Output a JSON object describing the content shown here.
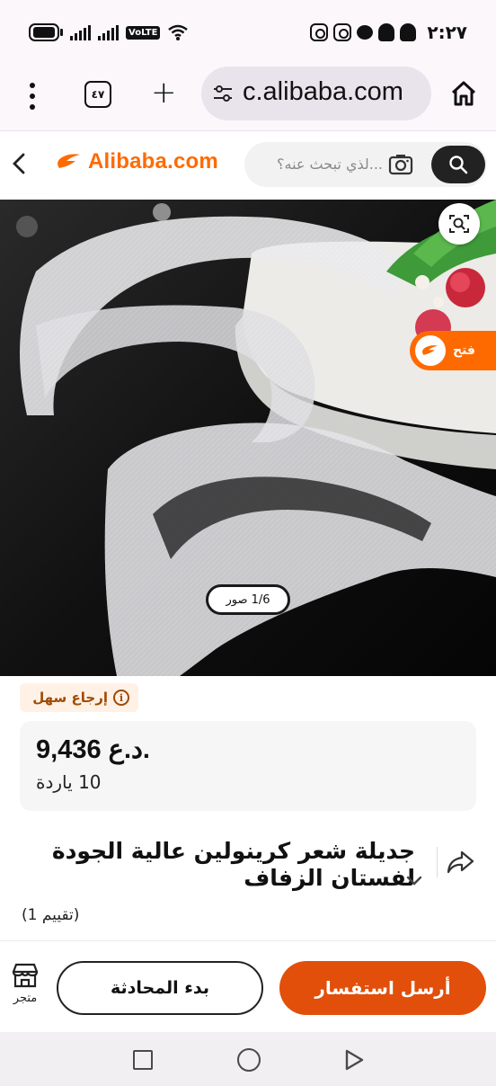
{
  "status_bar": {
    "time": "٢:٢٧",
    "network_label": "VoLTE",
    "icons": [
      "battery-icon",
      "signal-icon",
      "signal-icon",
      "volte-icon",
      "wifi-icon",
      "instagram-icon",
      "instagram-icon",
      "messenger-icon",
      "snapchat-icon",
      "snapchat-icon"
    ]
  },
  "browser": {
    "tab_count": "٤٧",
    "url": "c.alibaba.com",
    "icons": [
      "menu-dots-icon",
      "tabs-icon",
      "plus-icon",
      "site-settings-icon",
      "home-icon"
    ]
  },
  "header": {
    "brand": "Alibaba.com",
    "search_placeholder": "...لذي تبحث عنه؟",
    "icons": [
      "back-chevron-icon",
      "alibaba-logo-icon",
      "camera-icon",
      "search-icon"
    ]
  },
  "gallery": {
    "photo_counter": "1/6 صور",
    "open_app_label": "فتح",
    "icons": [
      "image-search-icon",
      "alibaba-app-icon"
    ]
  },
  "product": {
    "return_badge": "إرجاع سهل",
    "price": "9,436 د.ع.",
    "unit": "10 ياردة",
    "title": "جديلة شعر كرينولين عالية الجودة لفستان الزفاف",
    "rating": "(تقييم 1)",
    "icons": [
      "info-icon",
      "share-icon",
      "chevron-down-icon"
    ]
  },
  "actions": {
    "store_label": "متجر",
    "chat_label": "بدء المحادثة",
    "inquiry_label": "أرسل استفسار",
    "accent_color": "#e14f0b",
    "brand_color": "#ff6a00"
  },
  "nav": {
    "icons": [
      "recents-icon",
      "home-circle-icon",
      "back-triangle-icon"
    ]
  }
}
